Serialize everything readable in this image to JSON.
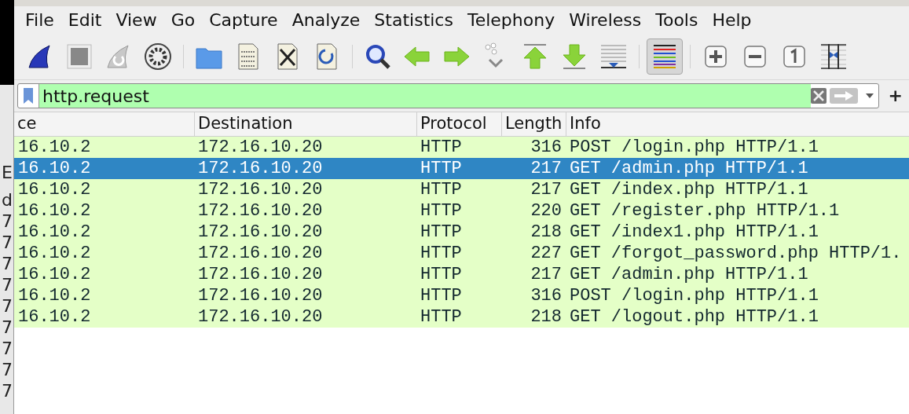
{
  "background_window": {
    "texts": [
      "E",
      "d",
      "7",
      "7",
      "7",
      "7",
      "7",
      "7",
      "7",
      "7",
      "7"
    ]
  },
  "menu": [
    {
      "label": "File"
    },
    {
      "label": "Edit"
    },
    {
      "label": "View"
    },
    {
      "label": "Go"
    },
    {
      "label": "Capture"
    },
    {
      "label": "Analyze"
    },
    {
      "label": "Statistics"
    },
    {
      "label": "Telephony"
    },
    {
      "label": "Wireless"
    },
    {
      "label": "Tools"
    },
    {
      "label": "Help"
    }
  ],
  "toolbar_groups": [
    [
      {
        "kind": "start",
        "pressed": false
      },
      {
        "kind": "stop",
        "pressed": false
      },
      {
        "kind": "restart",
        "pressed": false
      },
      {
        "kind": "options",
        "pressed": false
      }
    ],
    [
      {
        "kind": "open",
        "pressed": false
      },
      {
        "kind": "save",
        "pressed": false
      },
      {
        "kind": "close",
        "pressed": false
      },
      {
        "kind": "reload",
        "pressed": false
      }
    ],
    [
      {
        "kind": "find",
        "pressed": false
      },
      {
        "kind": "back",
        "pressed": false
      },
      {
        "kind": "forward",
        "pressed": false
      },
      {
        "kind": "goto",
        "pressed": false
      },
      {
        "kind": "first",
        "pressed": false
      },
      {
        "kind": "last",
        "pressed": false
      },
      {
        "kind": "autoscroll",
        "pressed": false
      }
    ],
    [
      {
        "kind": "colorize",
        "pressed": true
      }
    ],
    [
      {
        "kind": "zoom_in",
        "pressed": false
      },
      {
        "kind": "zoom_out",
        "pressed": false
      },
      {
        "kind": "normal_size",
        "pressed": false
      },
      {
        "kind": "resize_columns",
        "pressed": false
      }
    ]
  ],
  "filter": {
    "value": "http.request",
    "valid": true,
    "add_button": "+"
  },
  "packet_list": {
    "columns": [
      "ce",
      "Destination",
      "Protocol",
      "Length",
      "Info"
    ],
    "rows": [
      {
        "cells": [
          "16.10.2",
          "172.16.10.20",
          "HTTP",
          "316",
          "POST /login.php HTTP/1.1"
        ],
        "selected": false
      },
      {
        "cells": [
          "16.10.2",
          "172.16.10.20",
          "HTTP",
          "217",
          "GET /admin.php HTTP/1.1"
        ],
        "selected": true
      },
      {
        "cells": [
          "16.10.2",
          "172.16.10.20",
          "HTTP",
          "217",
          "GET /index.php HTTP/1.1"
        ],
        "selected": false
      },
      {
        "cells": [
          "16.10.2",
          "172.16.10.20",
          "HTTP",
          "220",
          "GET /register.php HTTP/1.1"
        ],
        "selected": false
      },
      {
        "cells": [
          "16.10.2",
          "172.16.10.20",
          "HTTP",
          "218",
          "GET /index1.php HTTP/1.1"
        ],
        "selected": false
      },
      {
        "cells": [
          "16.10.2",
          "172.16.10.20",
          "HTTP",
          "227",
          "GET /forgot_password.php HTTP/1."
        ],
        "selected": false
      },
      {
        "cells": [
          "16.10.2",
          "172.16.10.20",
          "HTTP",
          "217",
          "GET /admin.php HTTP/1.1"
        ],
        "selected": false
      },
      {
        "cells": [
          "16.10.2",
          "172.16.10.20",
          "HTTP",
          "316",
          "POST /login.php HTTP/1.1"
        ],
        "selected": false
      },
      {
        "cells": [
          "16.10.2",
          "172.16.10.20",
          "HTTP",
          "218",
          "GET /logout.php HTTP/1.1"
        ],
        "selected": false
      }
    ]
  }
}
